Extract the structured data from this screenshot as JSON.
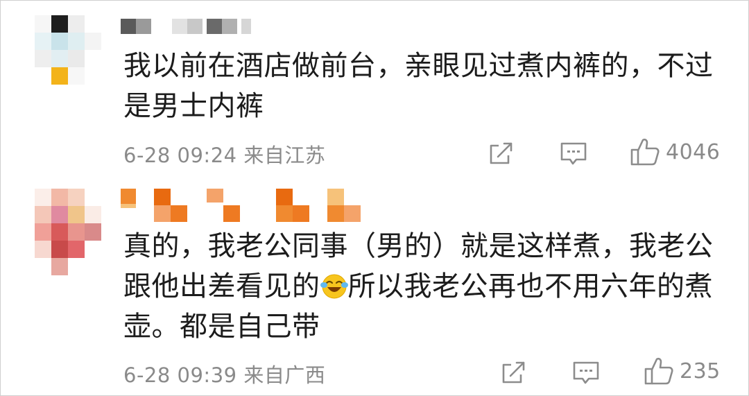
{
  "comments": [
    {
      "text_line1": "我以前在酒店做前台，亲眼见过煮内裤的，不过",
      "text_line2": "是男士内裤",
      "timestamp": "6-28 09:24",
      "location": "来自江苏",
      "like_count": "4046",
      "icons": {
        "share": "share-icon",
        "reply": "comment-icon",
        "like": "thumbs-up-icon"
      }
    },
    {
      "text_line1": "真的，我老公同事（男的）就是这样煮，我老公",
      "text_line2_part1": "跟他出差看见的",
      "text_line2_part2": "所以我老公再也不用六年的煮",
      "text_line3": "壶。都是自己带",
      "emoji": "laughing-crying-emoji",
      "timestamp": "6-28 09:39",
      "location": "来自广西",
      "like_count": "235",
      "icons": {
        "share": "share-icon",
        "reply": "comment-icon",
        "like": "thumbs-up-icon"
      }
    }
  ],
  "colors": {
    "text": "#1c1c1c",
    "meta": "#8a8a8a",
    "icon": "#8c8c8c",
    "nickname_pixels_1": [
      "#3a3a3a",
      "#b8b8b8",
      "#d4d4d4",
      "#5a5a5a",
      "#cfcfcf"
    ],
    "nickname_pixels_2": [
      "#f08a30",
      "#e86a10",
      "#f4a36a",
      "#ee7a22",
      "#f6c27a"
    ],
    "avatar_1": [
      "#1e1e1e",
      "#d8e8ee",
      "#f3b31a",
      "#eeeeee"
    ],
    "avatar_2": [
      "#f2b8a6",
      "#e2666a",
      "#f0c58a",
      "#c84a4a",
      "#e8958e"
    ]
  }
}
